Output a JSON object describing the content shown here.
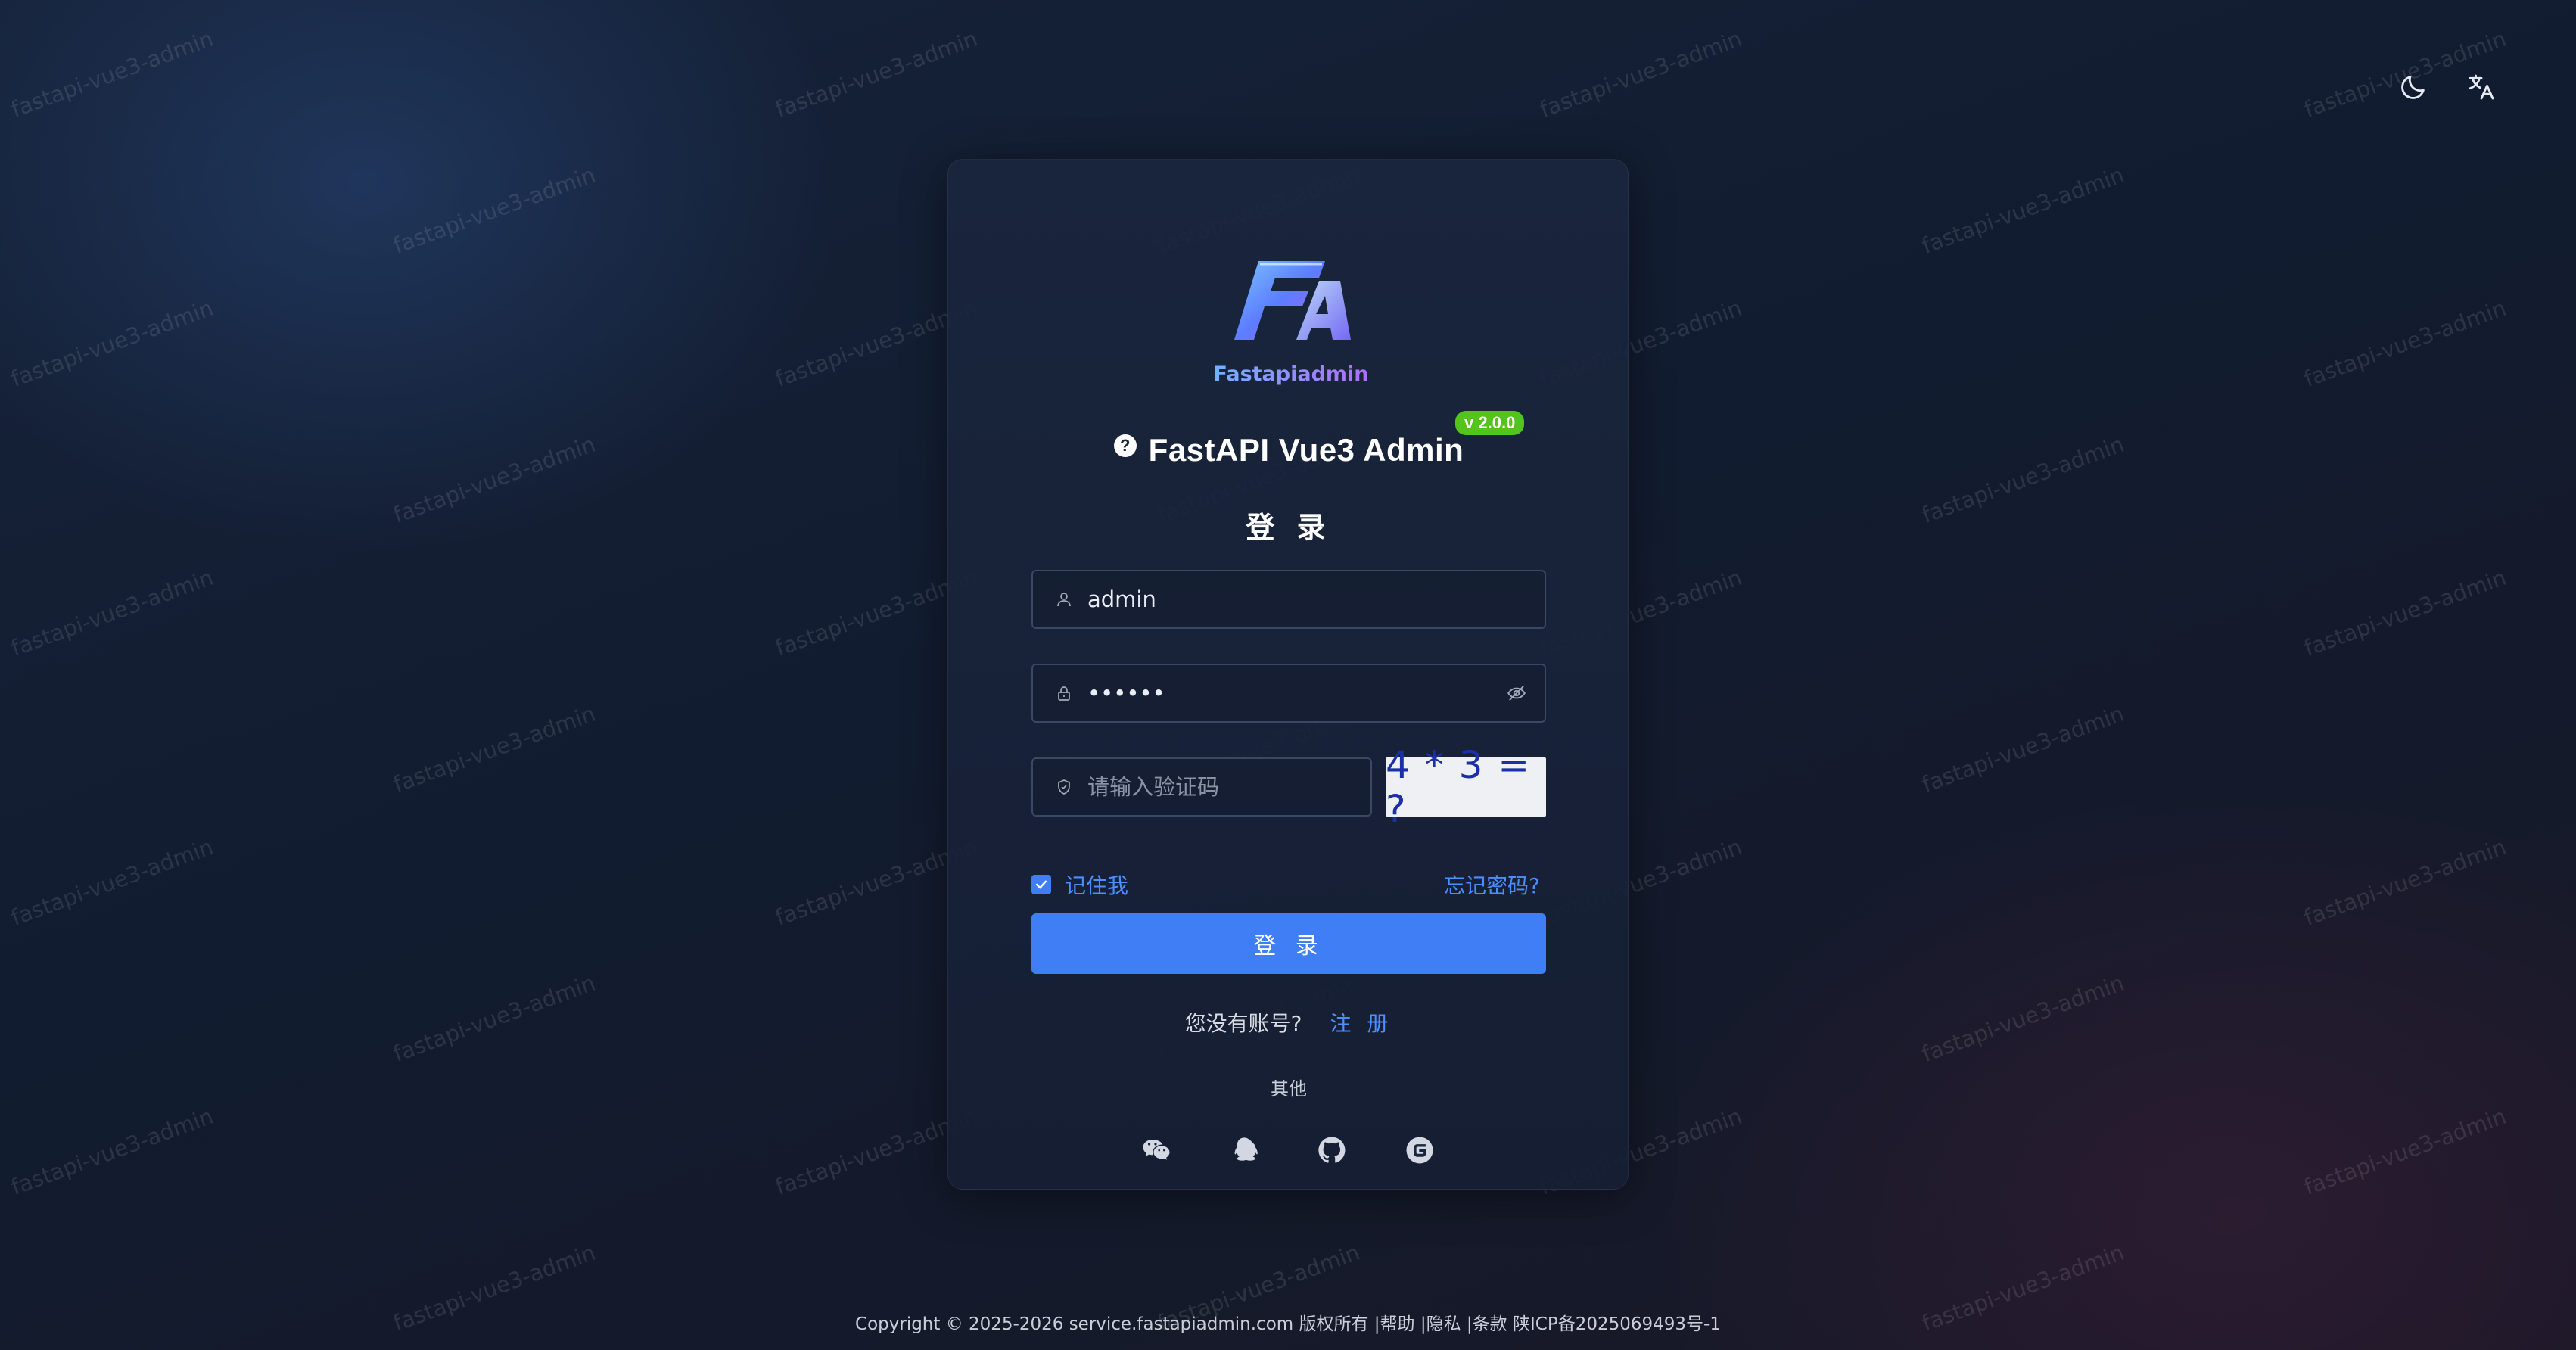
{
  "watermark_text": "fastapi-vue3-admin",
  "top_actions": {
    "theme_icon": "moon-icon",
    "language_icon": "translate-icon"
  },
  "logo": {
    "mark": "FA",
    "wordmark": "Fastapiadmin"
  },
  "app": {
    "title": "FastAPI Vue3 Admin",
    "version": "v 2.0.0",
    "help_icon_glyph": "?"
  },
  "form": {
    "heading": "登 录",
    "username": {
      "value": "admin",
      "icon": "user-icon"
    },
    "password": {
      "value": "••••••",
      "icon": "lock-icon",
      "toggle_icon": "eye-off-icon"
    },
    "captcha": {
      "placeholder": "请输入验证码",
      "icon": "shield-icon",
      "image_text": "4 * 3 = ?"
    },
    "remember_me": {
      "label": "记住我",
      "checked": true
    },
    "forgot_password": "忘记密码?",
    "submit_label": "登 录",
    "no_account_text": "您没有账号?",
    "register_label": "注 册",
    "other_divider": "其他"
  },
  "social_logins": [
    {
      "name": "wechat-icon"
    },
    {
      "name": "qq-icon"
    },
    {
      "name": "github-icon"
    },
    {
      "name": "gitee-icon"
    }
  ],
  "footer": {
    "copyright": "Copyright © 2025-2026 service.fastapiadmin.com 版权所有 ",
    "help": "|帮助",
    "privacy": " |隐私",
    "terms": " |条款",
    "icp": " 陕ICP备2025069493号-1"
  },
  "colors": {
    "accent": "#3f7ef5",
    "link": "#4c8dff",
    "badge": "#52c41a"
  }
}
